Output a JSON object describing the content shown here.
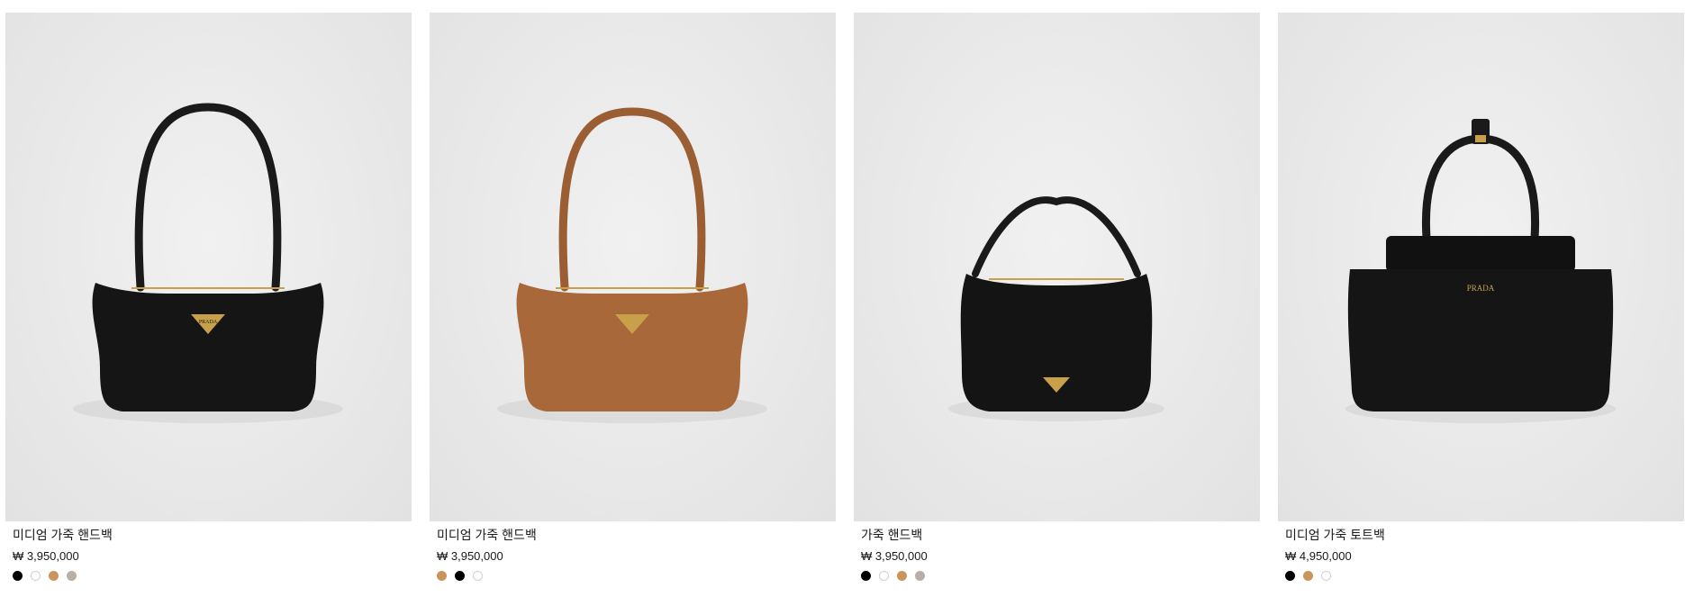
{
  "products": [
    {
      "name": "미디엄 가죽 핸드백",
      "price": "₩ 3,950,000",
      "image_alt": "미디엄 가죽 핸드백",
      "swatches": [
        "#000000",
        "#ffffff",
        "#c9955c",
        "#b8aea4"
      ]
    },
    {
      "name": "미디엄 가죽 핸드백",
      "price": "₩ 3,950,000",
      "image_alt": "미디엄 가죽 핸드백",
      "swatches": [
        "#c9955c",
        "#000000",
        "#ffffff"
      ]
    },
    {
      "name": "가죽 핸드백",
      "price": "₩ 3,950,000",
      "image_alt": "가죽 핸드백",
      "swatches": [
        "#000000",
        "#ffffff",
        "#c9955c",
        "#b8aea4"
      ]
    },
    {
      "name": "미디엄 가죽 토트백",
      "price": "₩ 4,950,000",
      "image_alt": "미디엄 가죽 토트백",
      "swatches": [
        "#000000",
        "#c9955c",
        "#ffffff"
      ]
    }
  ],
  "brand_mark": "PRADA",
  "colors": {
    "leather_black": "#151515",
    "leather_tan": "#a8683a",
    "hardware_gold": "#c8a04a",
    "background": "#e9e9e9"
  }
}
